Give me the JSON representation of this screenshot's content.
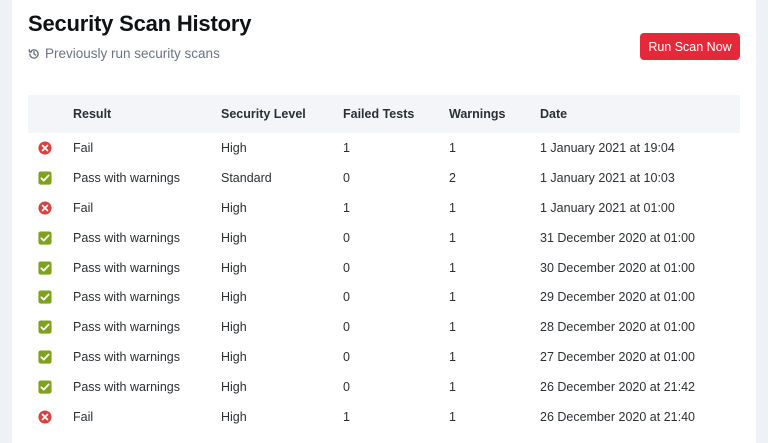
{
  "header": {
    "title": "Security Scan History",
    "subtitle": "Previously run security scans",
    "subtitle_icon": "history-icon",
    "run_button_label": "Run Scan Now"
  },
  "colors": {
    "accent": "#e5293a",
    "pass": "#7fa11c",
    "fail": "#d94040",
    "header_row": "#f3f5f9",
    "page_bg": "#eef1f6"
  },
  "table": {
    "columns": [
      "",
      "Result",
      "Security Level",
      "Failed Tests",
      "Warnings",
      "Date"
    ],
    "rows": [
      {
        "status": "fail",
        "status_icon": "x-circle-icon",
        "result": "Fail",
        "level": "High",
        "failed": "1",
        "warnings": "1",
        "date": "1 January 2021 at 19:04"
      },
      {
        "status": "pass",
        "status_icon": "checkbox-icon",
        "result": "Pass with warnings",
        "level": "Standard",
        "failed": "0",
        "warnings": "2",
        "date": "1 January 2021 at 10:03"
      },
      {
        "status": "fail",
        "status_icon": "x-circle-icon",
        "result": "Fail",
        "level": "High",
        "failed": "1",
        "warnings": "1",
        "date": "1 January 2021 at 01:00"
      },
      {
        "status": "pass",
        "status_icon": "checkbox-icon",
        "result": "Pass with warnings",
        "level": "High",
        "failed": "0",
        "warnings": "1",
        "date": "31 December 2020 at 01:00"
      },
      {
        "status": "pass",
        "status_icon": "checkbox-icon",
        "result": "Pass with warnings",
        "level": "High",
        "failed": "0",
        "warnings": "1",
        "date": "30 December 2020 at 01:00"
      },
      {
        "status": "pass",
        "status_icon": "checkbox-icon",
        "result": "Pass with warnings",
        "level": "High",
        "failed": "0",
        "warnings": "1",
        "date": "29 December 2020 at 01:00"
      },
      {
        "status": "pass",
        "status_icon": "checkbox-icon",
        "result": "Pass with warnings",
        "level": "High",
        "failed": "0",
        "warnings": "1",
        "date": "28 December 2020 at 01:00"
      },
      {
        "status": "pass",
        "status_icon": "checkbox-icon",
        "result": "Pass with warnings",
        "level": "High",
        "failed": "0",
        "warnings": "1",
        "date": "27 December 2020 at 01:00"
      },
      {
        "status": "pass",
        "status_icon": "checkbox-icon",
        "result": "Pass with warnings",
        "level": "High",
        "failed": "0",
        "warnings": "1",
        "date": "26 December 2020 at 21:42"
      },
      {
        "status": "fail",
        "status_icon": "x-circle-icon",
        "result": "Fail",
        "level": "High",
        "failed": "1",
        "warnings": "1",
        "date": "26 December 2020 at 21:40"
      }
    ]
  }
}
